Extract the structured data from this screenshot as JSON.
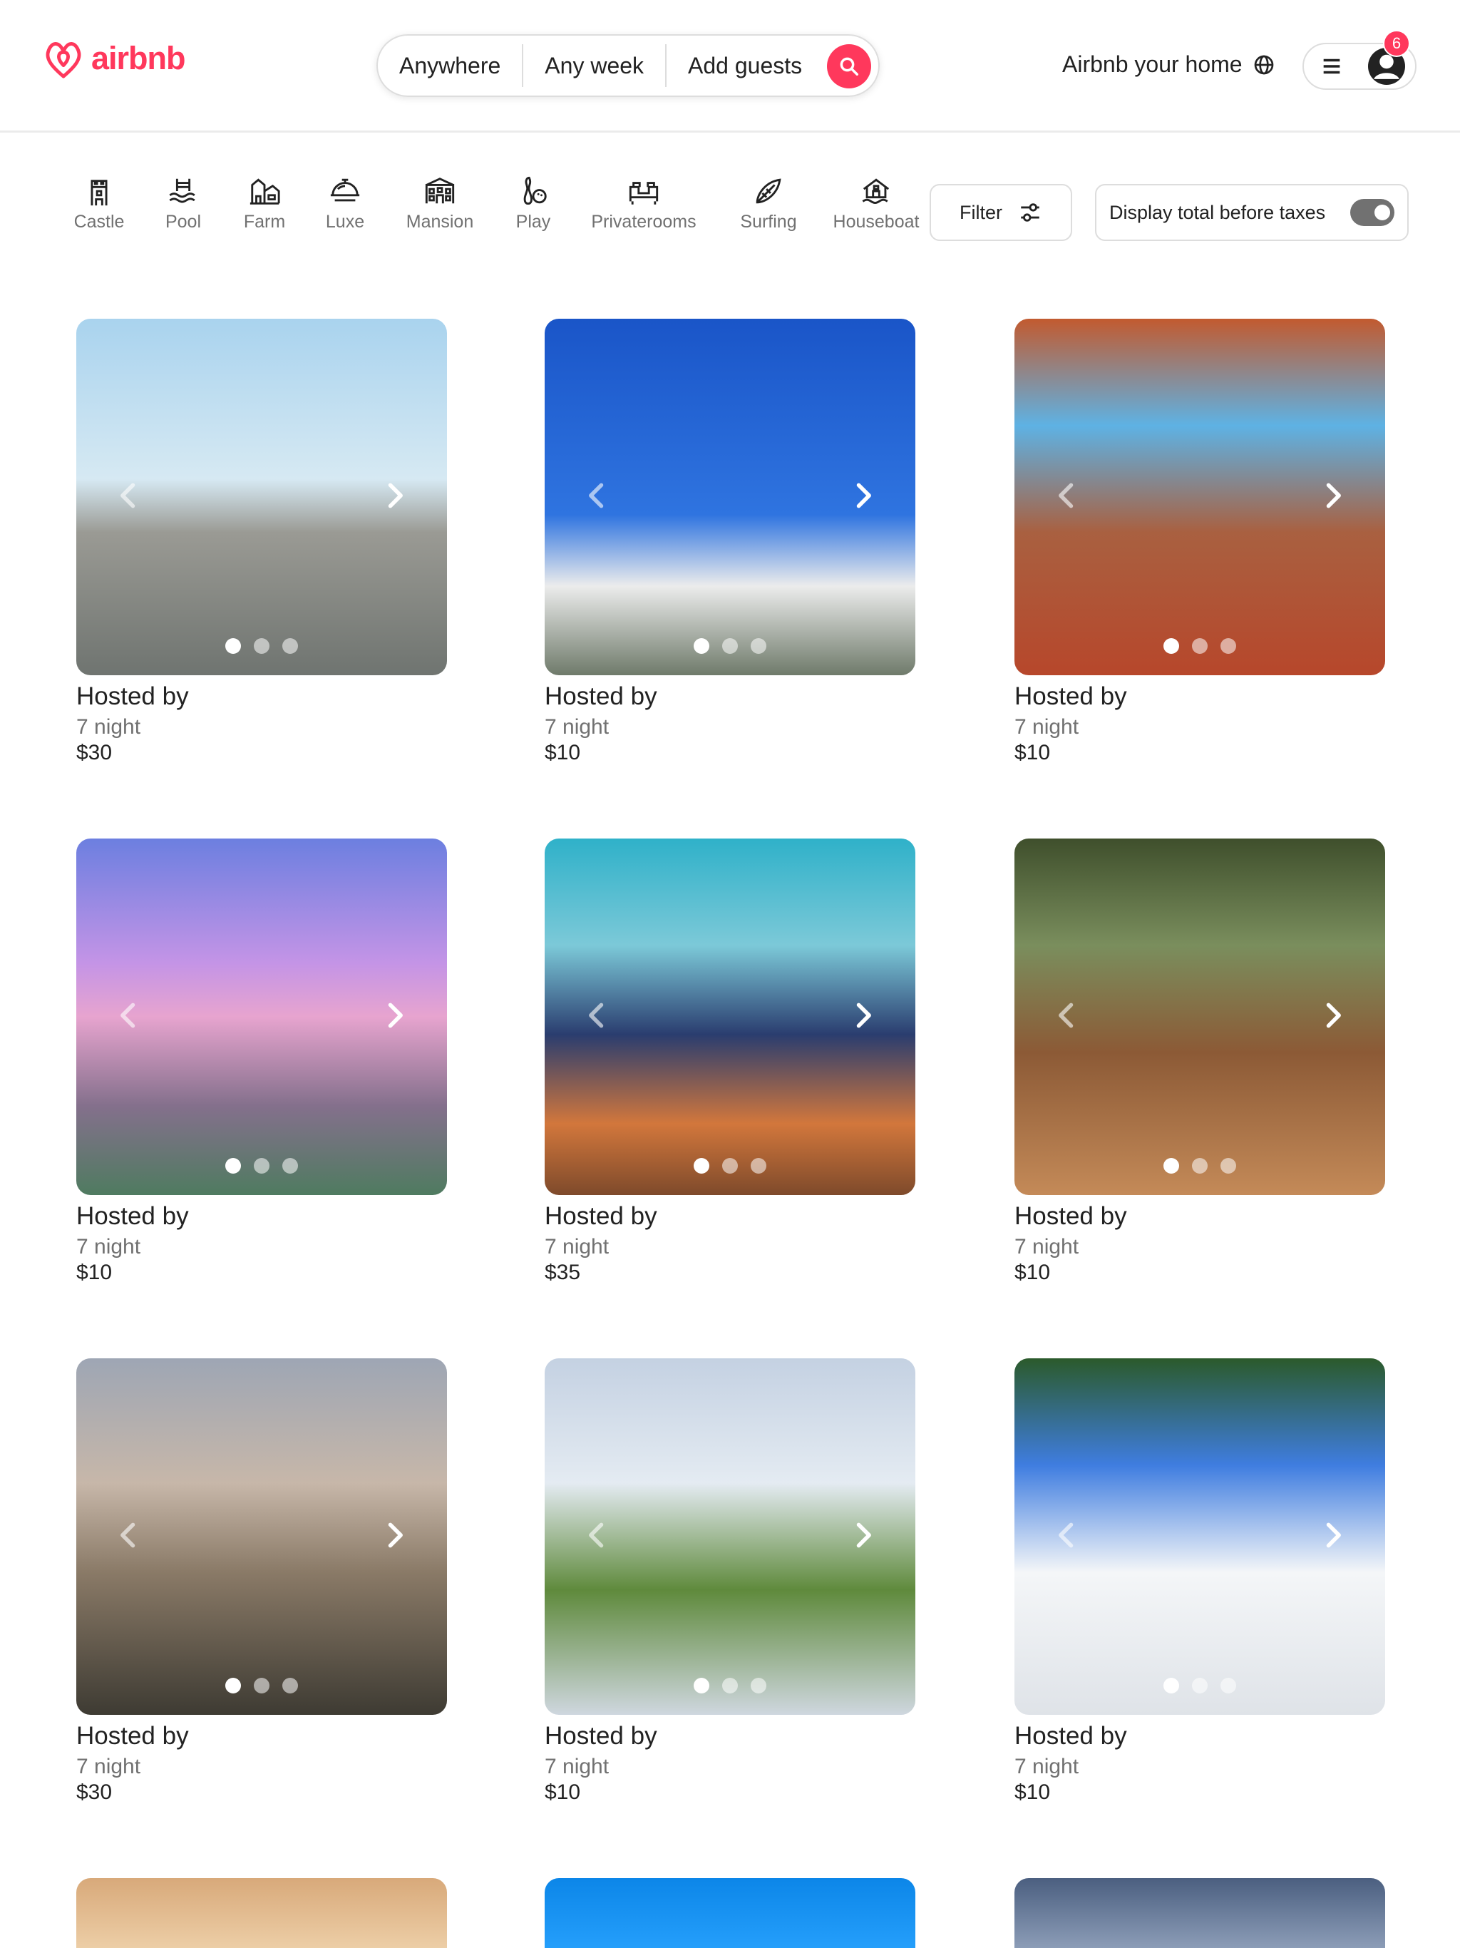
{
  "header": {
    "logo_text": "airbnb",
    "search": {
      "where": "Anywhere",
      "when": "Any week",
      "who": "Add guests"
    },
    "host_link": "Airbnb your home",
    "notification_count": "6"
  },
  "categories": [
    {
      "label": "Castle",
      "icon": "castle-icon"
    },
    {
      "label": "Pool",
      "icon": "pool-icon"
    },
    {
      "label": "Farm",
      "icon": "farm-icon"
    },
    {
      "label": "Luxe",
      "icon": "luxe-icon"
    },
    {
      "label": "Mansion",
      "icon": "mansion-icon"
    },
    {
      "label": "Play",
      "icon": "play-icon"
    },
    {
      "label": "Privaterooms",
      "icon": "private-room-icon"
    },
    {
      "label": "Surfing",
      "icon": "surfing-icon"
    },
    {
      "label": "Houseboat",
      "icon": "houseboat-icon"
    }
  ],
  "filters": {
    "filter_label": "Filter",
    "tax_toggle_label": "Display total before taxes",
    "tax_toggle_on": true
  },
  "listings": [
    {
      "title": "Hosted by",
      "nights": "7 night",
      "price": "$30",
      "dots": 3,
      "active_dot": 0
    },
    {
      "title": "Hosted by",
      "nights": "7 night",
      "price": "$10",
      "dots": 3,
      "active_dot": 0
    },
    {
      "title": "Hosted by",
      "nights": "7 night",
      "price": "$10",
      "dots": 3,
      "active_dot": 0
    },
    {
      "title": "Hosted by",
      "nights": "7 night",
      "price": "$10",
      "dots": 3,
      "active_dot": 0
    },
    {
      "title": "Hosted by",
      "nights": "7 night",
      "price": "$35",
      "dots": 3,
      "active_dot": 0
    },
    {
      "title": "Hosted by",
      "nights": "7 night",
      "price": "$10",
      "dots": 3,
      "active_dot": 0
    },
    {
      "title": "Hosted by",
      "nights": "7 night",
      "price": "$30",
      "dots": 3,
      "active_dot": 0
    },
    {
      "title": "Hosted by",
      "nights": "7 night",
      "price": "$10",
      "dots": 3,
      "active_dot": 0
    },
    {
      "title": "Hosted by",
      "nights": "7 night",
      "price": "$10",
      "dots": 3,
      "active_dot": 0
    }
  ],
  "colors": {
    "brand": "#ff385c",
    "text": "#222222",
    "muted": "#717171",
    "border": "#dddddd"
  }
}
